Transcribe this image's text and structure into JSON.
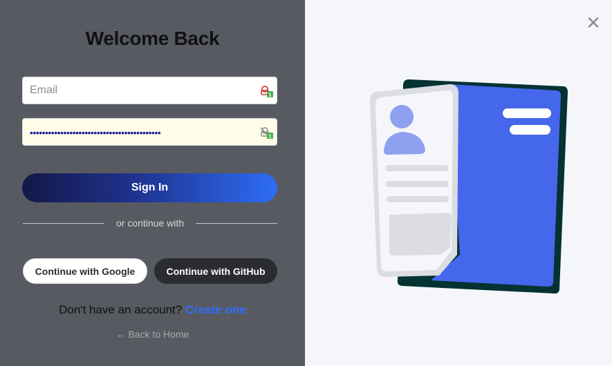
{
  "login": {
    "title": "Welcome Back",
    "email_placeholder": "Email",
    "password_value_masked": "•••••••••••••••••••••••••••••••••••••••••••",
    "sign_in_label": "Sign In",
    "divider_label": "or continue with",
    "google_label": "Continue with Google",
    "github_label": "Continue with GitHub",
    "signup_prompt": "Don't have an account?",
    "signup_link": "Create one",
    "back_link": "← Back to Home"
  },
  "window": {
    "close_glyph": "✕"
  },
  "icons": {
    "email_field_icon": "password-manager-icon",
    "password_field_icon": "password-manager-hidden-icon",
    "illustration": "id-card-illustration"
  },
  "colors": {
    "left_panel": "#585a62",
    "right_panel": "#f5f6fa",
    "accent": "#2f6bff",
    "card_blue": "#4567eb",
    "card_dark": "#053232"
  }
}
